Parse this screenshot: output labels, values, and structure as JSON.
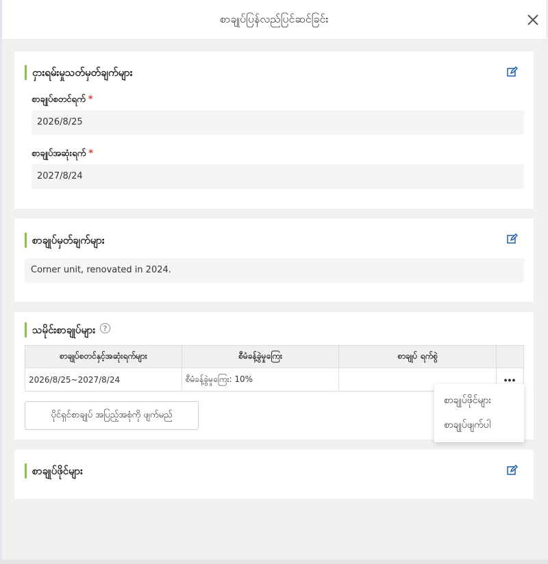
{
  "modal": {
    "title": "စာချုပ်ပြန်လည်ပြင်ဆင်ခြင်း"
  },
  "rental_info": {
    "title": "ငှားရမ်းမှုသတ်မှတ်ချက်များ",
    "start_label": "စာချုပ်စတင်ရက်",
    "start_value": "2026/8/25",
    "end_label": "စာချုပ်အဆုံးရက်",
    "end_value": "2027/8/24",
    "required_mark": "*"
  },
  "contract_notes": {
    "title": "စာချုပ်မှတ်ချက်များ",
    "note": "Corner unit, renovated in 2024."
  },
  "history": {
    "title": "သမိုင်းစာချုပ်များ",
    "columns": [
      "စာချုပ်စတင်နှင့်အဆုံးရက်များ",
      "စီမံခန့်ခွဲမှုကြေး",
      "စာချုပ် ရက်စွဲ"
    ],
    "rows": [
      {
        "period": "2026/8/25~2027/8/24",
        "mgmt_fee": "စီမံခန့်ခွဲမှုကြေး: 10%",
        "contract_date": ""
      }
    ],
    "more_label": "•••",
    "add_button": "ပိုင်ရှင်စာချုပ် အပြည့်အစုံကို ဖျက်မည်"
  },
  "row_menu": {
    "items": [
      "စာချုပ်ဖိုင်များ",
      "စာချုပ်ဖျက်ပါ"
    ]
  },
  "contract_files": {
    "title": "စာချုပ်ဖိုင်များ"
  },
  "colors": {
    "accent_bar": "#8bc34a",
    "edit_icon": "#1f5fa8",
    "required": "#e53935"
  },
  "icons": {
    "close": "close-icon",
    "edit": "edit-icon",
    "help": "help-icon"
  }
}
